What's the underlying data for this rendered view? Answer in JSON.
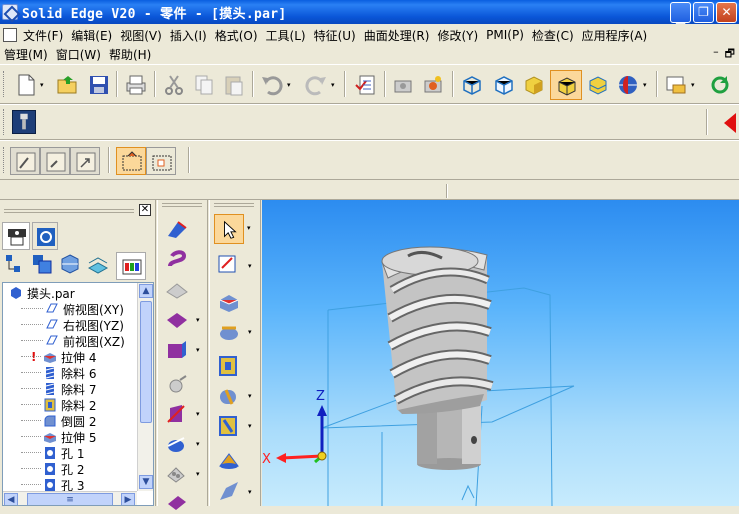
{
  "window": {
    "title": "Solid Edge V20 - 零件 - [摸头.par]"
  },
  "menu": {
    "row1": [
      "文件(F)",
      "编辑(E)",
      "视图(V)",
      "插入(I)",
      "格式(O)",
      "工具(L)",
      "特征(U)",
      "曲面处理(R)",
      "修改(Y)",
      "PMI(P)",
      "检查(C)",
      "应用程序(A)"
    ],
    "row2": [
      "管理(M)",
      "窗口(W)",
      "帮助(H)"
    ]
  },
  "tree": {
    "items": [
      {
        "label": "摸头.par",
        "icon": "part-icon",
        "level": 0
      },
      {
        "label": "俯视图(XY)",
        "icon": "plane-icon",
        "level": 2
      },
      {
        "label": "右视图(YZ)",
        "icon": "plane-icon",
        "level": 2
      },
      {
        "label": "前视图(XZ)",
        "icon": "plane-icon",
        "level": 2
      },
      {
        "label": "拉伸 4",
        "icon": "protrusion-icon",
        "level": 1,
        "warning": true
      },
      {
        "label": "除料 6",
        "icon": "helix-cutout-icon",
        "level": 1
      },
      {
        "label": "除料 7",
        "icon": "helix-cutout-icon",
        "level": 1
      },
      {
        "label": "除料 2",
        "icon": "cutout-icon",
        "level": 1
      },
      {
        "label": "倒圆 2",
        "icon": "round-icon",
        "level": 1
      },
      {
        "label": "拉伸 5",
        "icon": "protrusion-icon",
        "level": 1
      },
      {
        "label": "孔 1",
        "icon": "hole-icon",
        "level": 1
      },
      {
        "label": "孔 2",
        "icon": "hole-icon",
        "level": 1
      },
      {
        "label": "孔 3",
        "icon": "hole-icon",
        "level": 1
      }
    ]
  },
  "viewport": {
    "axis_x": "X",
    "axis_z": "Z",
    "colors": {
      "axis_x": "#ff2020",
      "axis_z": "#1020c0",
      "axis_y": "#20c020",
      "plane": "#3fa0e0",
      "model": "#c8c8c8"
    }
  }
}
